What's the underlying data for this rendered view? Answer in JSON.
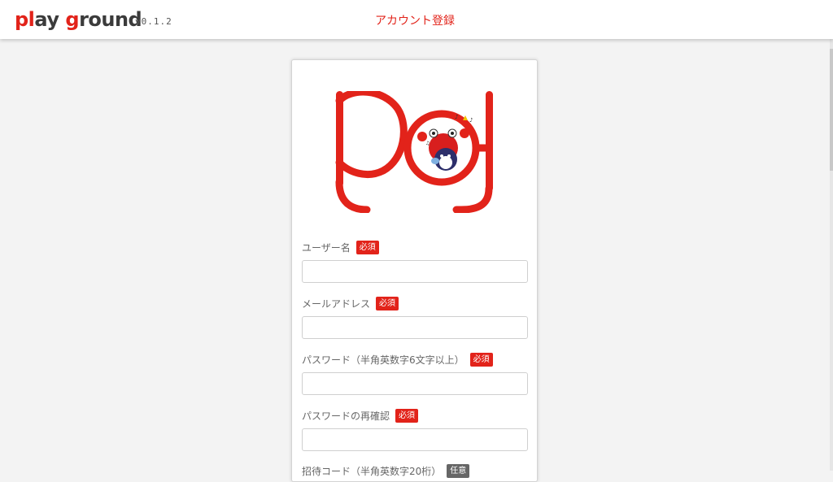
{
  "header": {
    "logo_text_a": "pl",
    "logo_text_b": "ay ",
    "logo_text_c": "g",
    "logo_text_d": "round",
    "version": "v0.1.2",
    "title": "アカウント登録"
  },
  "colors": {
    "accent": "#e2231a",
    "label": "#666666",
    "optional_badge": "#666666"
  },
  "form": {
    "fields": [
      {
        "label": "ユーザー名",
        "badge": "必須",
        "value": ""
      },
      {
        "label": "メールアドレス",
        "badge": "必須",
        "value": ""
      },
      {
        "label": "パスワード（半角英数字6文字以上）",
        "badge": "必須",
        "value": ""
      },
      {
        "label": "パスワードの再確認",
        "badge": "必須",
        "value": ""
      },
      {
        "label": "招待コード（半角英数字20桁）",
        "badge": "任意",
        "value": ""
      }
    ]
  }
}
